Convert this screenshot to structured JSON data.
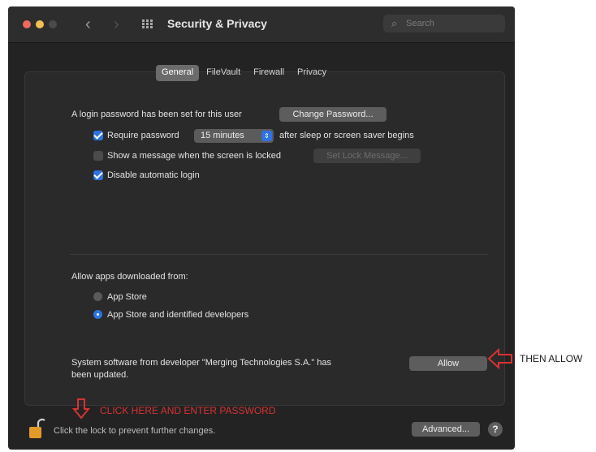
{
  "window": {
    "title": "Security & Privacy",
    "search_placeholder": "Search"
  },
  "tabs": [
    {
      "label": "General",
      "active": true
    },
    {
      "label": "FileVault",
      "active": false
    },
    {
      "label": "Firewall",
      "active": false
    },
    {
      "label": "Privacy",
      "active": false
    }
  ],
  "general": {
    "login_password_text": "A login password has been set for this user",
    "change_password_label": "Change Password...",
    "require_password": {
      "label": "Require password",
      "checked": true,
      "interval": "15 minutes",
      "suffix": "after sleep or screen saver begins"
    },
    "show_message": {
      "label": "Show a message when the screen is locked",
      "checked": false,
      "button_label": "Set Lock Message..."
    },
    "disable_auto_login": {
      "label": "Disable automatic login",
      "checked": true
    }
  },
  "apps": {
    "heading": "Allow apps downloaded from:",
    "options": [
      {
        "label": "App Store",
        "selected": false
      },
      {
        "label": "App Store and identified developers",
        "selected": true
      }
    ]
  },
  "system_software": {
    "message_line1": "System software from developer \"Merging Technologies S.A.\" has",
    "message_line2": "been updated.",
    "allow_label": "Allow"
  },
  "footer": {
    "lock_text": "Click the lock to prevent further changes.",
    "advanced_label": "Advanced...",
    "help_label": "?"
  },
  "annotations": {
    "click_here": "CLICK HERE AND ENTER PASSWORD",
    "then_allow": "THEN ALLOW",
    "color": "#d83232"
  },
  "colors": {
    "accent": "#2f73e2",
    "window_bg": "#232323"
  }
}
